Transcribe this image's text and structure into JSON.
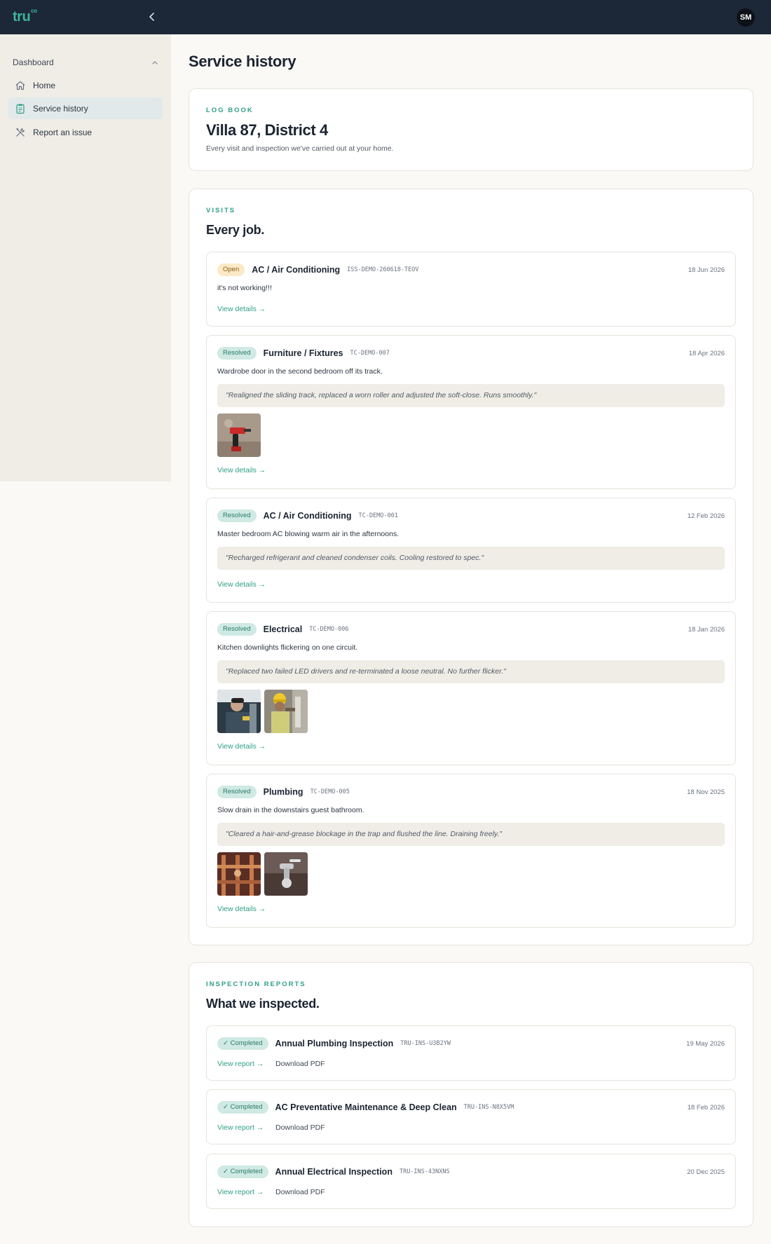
{
  "app": {
    "logo": "tru",
    "logo_sup": "co",
    "user_initials": "SM"
  },
  "sidebar": {
    "section": "Dashboard",
    "items": [
      {
        "label": "Home"
      },
      {
        "label": "Service history"
      },
      {
        "label": "Report an issue"
      }
    ]
  },
  "page": {
    "title": "Service history"
  },
  "logbook": {
    "eyebrow": "LOG BOOK",
    "title": "Villa 87, District 4",
    "subtitle": "Every visit and inspection we've carried out at your home."
  },
  "visits": {
    "eyebrow": "VISITS",
    "title": "Every job.",
    "items": [
      {
        "status": "Open",
        "category": "AC / Air Conditioning",
        "code": "ISS-DEMO-260618-TEOV",
        "date": "18 Jun 2026",
        "description": "it's not working!!!",
        "link": "View details →"
      },
      {
        "status": "Resolved",
        "category": "Furniture / Fixtures",
        "code": "TC-DEMO-007",
        "date": "18 Apr 2026",
        "description": "Wardrobe door in the second bedroom off its track.",
        "note": "\"Realigned the sliding track, replaced a worn roller and adjusted the soft-close. Runs smoothly.\"",
        "link": "View details →"
      },
      {
        "status": "Resolved",
        "category": "AC / Air Conditioning",
        "code": "TC-DEMO-001",
        "date": "12 Feb 2026",
        "description": "Master bedroom AC blowing warm air in the afternoons.",
        "note": "\"Recharged refrigerant and cleaned condenser coils. Cooling restored to spec.\"",
        "link": "View details →"
      },
      {
        "status": "Resolved",
        "category": "Electrical",
        "code": "TC-DEMO-006",
        "date": "18 Jan 2026",
        "description": "Kitchen downlights flickering on one circuit.",
        "note": "\"Replaced two failed LED drivers and re-terminated a loose neutral. No further flicker.\"",
        "link": "View details →"
      },
      {
        "status": "Resolved",
        "category": "Plumbing",
        "code": "TC-DEMO-005",
        "date": "18 Nov 2025",
        "description": "Slow drain in the downstairs guest bathroom.",
        "note": "\"Cleared a hair-and-grease blockage in the trap and flushed the line. Draining freely.\"",
        "link": "View details →"
      }
    ]
  },
  "inspections": {
    "eyebrow": "INSPECTION REPORTS",
    "title": "What we inspected.",
    "items": [
      {
        "status": "✓ Completed",
        "title": "Annual Plumbing Inspection",
        "code": "TRU-INS-U3B2YW",
        "date": "19 May 2026",
        "view": "View report →",
        "download": "Download PDF"
      },
      {
        "status": "✓ Completed",
        "title": "AC Preventative Maintenance & Deep Clean",
        "code": "TRU-INS-N8X5VM",
        "date": "18 Feb 2026",
        "view": "View report →",
        "download": "Download PDF"
      },
      {
        "status": "✓ Completed",
        "title": "Annual Electrical Inspection",
        "code": "TRU-INS-43NXNS",
        "date": "20 Dec 2025",
        "view": "View report →",
        "download": "Download PDF"
      }
    ]
  }
}
